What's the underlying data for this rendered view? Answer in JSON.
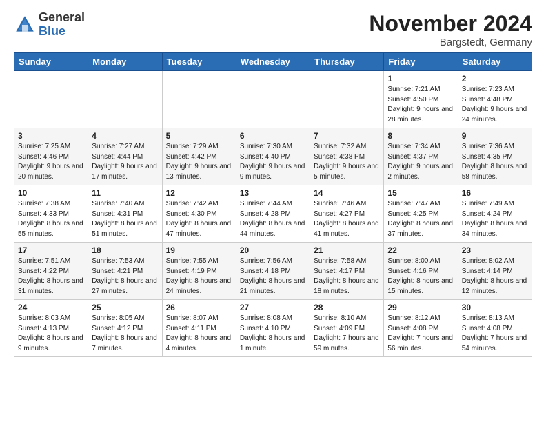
{
  "header": {
    "logo_general": "General",
    "logo_blue": "Blue",
    "month_title": "November 2024",
    "location": "Bargstedt, Germany"
  },
  "days_of_week": [
    "Sunday",
    "Monday",
    "Tuesday",
    "Wednesday",
    "Thursday",
    "Friday",
    "Saturday"
  ],
  "weeks": [
    [
      {
        "day": "",
        "info": ""
      },
      {
        "day": "",
        "info": ""
      },
      {
        "day": "",
        "info": ""
      },
      {
        "day": "",
        "info": ""
      },
      {
        "day": "",
        "info": ""
      },
      {
        "day": "1",
        "info": "Sunrise: 7:21 AM\nSunset: 4:50 PM\nDaylight: 9 hours\nand 28 minutes."
      },
      {
        "day": "2",
        "info": "Sunrise: 7:23 AM\nSunset: 4:48 PM\nDaylight: 9 hours\nand 24 minutes."
      }
    ],
    [
      {
        "day": "3",
        "info": "Sunrise: 7:25 AM\nSunset: 4:46 PM\nDaylight: 9 hours\nand 20 minutes."
      },
      {
        "day": "4",
        "info": "Sunrise: 7:27 AM\nSunset: 4:44 PM\nDaylight: 9 hours\nand 17 minutes."
      },
      {
        "day": "5",
        "info": "Sunrise: 7:29 AM\nSunset: 4:42 PM\nDaylight: 9 hours\nand 13 minutes."
      },
      {
        "day": "6",
        "info": "Sunrise: 7:30 AM\nSunset: 4:40 PM\nDaylight: 9 hours\nand 9 minutes."
      },
      {
        "day": "7",
        "info": "Sunrise: 7:32 AM\nSunset: 4:38 PM\nDaylight: 9 hours\nand 5 minutes."
      },
      {
        "day": "8",
        "info": "Sunrise: 7:34 AM\nSunset: 4:37 PM\nDaylight: 9 hours\nand 2 minutes."
      },
      {
        "day": "9",
        "info": "Sunrise: 7:36 AM\nSunset: 4:35 PM\nDaylight: 8 hours\nand 58 minutes."
      }
    ],
    [
      {
        "day": "10",
        "info": "Sunrise: 7:38 AM\nSunset: 4:33 PM\nDaylight: 8 hours\nand 55 minutes."
      },
      {
        "day": "11",
        "info": "Sunrise: 7:40 AM\nSunset: 4:31 PM\nDaylight: 8 hours\nand 51 minutes."
      },
      {
        "day": "12",
        "info": "Sunrise: 7:42 AM\nSunset: 4:30 PM\nDaylight: 8 hours\nand 47 minutes."
      },
      {
        "day": "13",
        "info": "Sunrise: 7:44 AM\nSunset: 4:28 PM\nDaylight: 8 hours\nand 44 minutes."
      },
      {
        "day": "14",
        "info": "Sunrise: 7:46 AM\nSunset: 4:27 PM\nDaylight: 8 hours\nand 41 minutes."
      },
      {
        "day": "15",
        "info": "Sunrise: 7:47 AM\nSunset: 4:25 PM\nDaylight: 8 hours\nand 37 minutes."
      },
      {
        "day": "16",
        "info": "Sunrise: 7:49 AM\nSunset: 4:24 PM\nDaylight: 8 hours\nand 34 minutes."
      }
    ],
    [
      {
        "day": "17",
        "info": "Sunrise: 7:51 AM\nSunset: 4:22 PM\nDaylight: 8 hours\nand 31 minutes."
      },
      {
        "day": "18",
        "info": "Sunrise: 7:53 AM\nSunset: 4:21 PM\nDaylight: 8 hours\nand 27 minutes."
      },
      {
        "day": "19",
        "info": "Sunrise: 7:55 AM\nSunset: 4:19 PM\nDaylight: 8 hours\nand 24 minutes."
      },
      {
        "day": "20",
        "info": "Sunrise: 7:56 AM\nSunset: 4:18 PM\nDaylight: 8 hours\nand 21 minutes."
      },
      {
        "day": "21",
        "info": "Sunrise: 7:58 AM\nSunset: 4:17 PM\nDaylight: 8 hours\nand 18 minutes."
      },
      {
        "day": "22",
        "info": "Sunrise: 8:00 AM\nSunset: 4:16 PM\nDaylight: 8 hours\nand 15 minutes."
      },
      {
        "day": "23",
        "info": "Sunrise: 8:02 AM\nSunset: 4:14 PM\nDaylight: 8 hours\nand 12 minutes."
      }
    ],
    [
      {
        "day": "24",
        "info": "Sunrise: 8:03 AM\nSunset: 4:13 PM\nDaylight: 8 hours\nand 9 minutes."
      },
      {
        "day": "25",
        "info": "Sunrise: 8:05 AM\nSunset: 4:12 PM\nDaylight: 8 hours\nand 7 minutes."
      },
      {
        "day": "26",
        "info": "Sunrise: 8:07 AM\nSunset: 4:11 PM\nDaylight: 8 hours\nand 4 minutes."
      },
      {
        "day": "27",
        "info": "Sunrise: 8:08 AM\nSunset: 4:10 PM\nDaylight: 8 hours\nand 1 minute."
      },
      {
        "day": "28",
        "info": "Sunrise: 8:10 AM\nSunset: 4:09 PM\nDaylight: 7 hours\nand 59 minutes."
      },
      {
        "day": "29",
        "info": "Sunrise: 8:12 AM\nSunset: 4:08 PM\nDaylight: 7 hours\nand 56 minutes."
      },
      {
        "day": "30",
        "info": "Sunrise: 8:13 AM\nSunset: 4:08 PM\nDaylight: 7 hours\nand 54 minutes."
      }
    ]
  ]
}
